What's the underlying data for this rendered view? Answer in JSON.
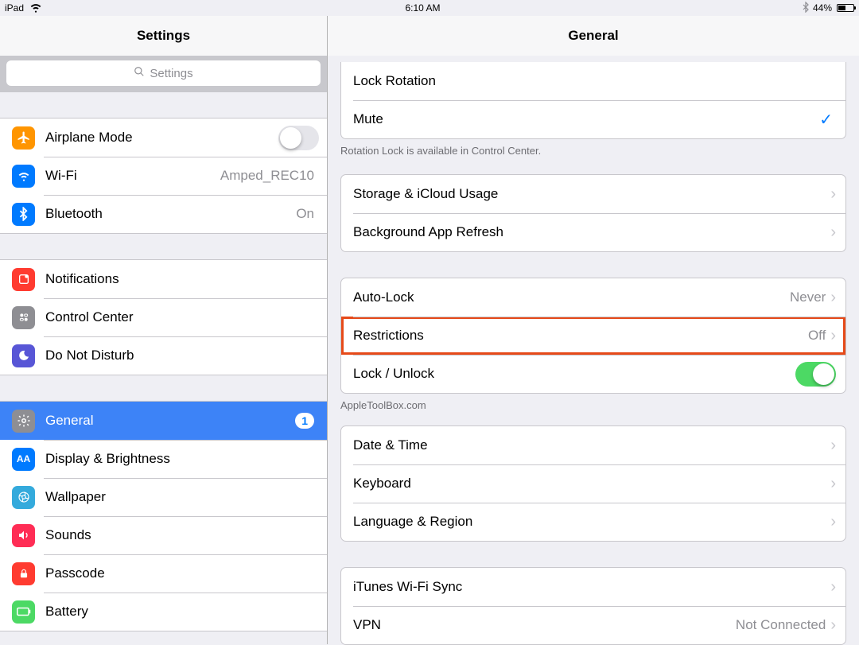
{
  "statusbar": {
    "device": "iPad",
    "time": "6:10 AM",
    "battery_percent": "44%"
  },
  "sidebar": {
    "title": "Settings",
    "search_placeholder": "Settings",
    "rows": {
      "airplane": {
        "label": "Airplane Mode"
      },
      "wifi": {
        "label": "Wi-Fi",
        "value": "Amped_REC10"
      },
      "bluetooth": {
        "label": "Bluetooth",
        "value": "On"
      },
      "notifications": {
        "label": "Notifications"
      },
      "controlcenter": {
        "label": "Control Center"
      },
      "dnd": {
        "label": "Do Not Disturb"
      },
      "general": {
        "label": "General",
        "badge": "1"
      },
      "display": {
        "label": "Display & Brightness"
      },
      "wallpaper": {
        "label": "Wallpaper"
      },
      "sounds": {
        "label": "Sounds"
      },
      "passcode": {
        "label": "Passcode"
      },
      "battery": {
        "label": "Battery"
      }
    }
  },
  "detail": {
    "title": "General",
    "rows": {
      "lockrotation": {
        "label": "Lock Rotation"
      },
      "mute": {
        "label": "Mute"
      },
      "rotation_footer": "Rotation Lock is available in Control Center.",
      "storage": {
        "label": "Storage & iCloud Usage"
      },
      "bgrefresh": {
        "label": "Background App Refresh"
      },
      "autolock": {
        "label": "Auto-Lock",
        "value": "Never"
      },
      "restrictions": {
        "label": "Restrictions",
        "value": "Off"
      },
      "lockunlock": {
        "label": "Lock / Unlock"
      },
      "watermark": "AppleToolBox.com",
      "datetime": {
        "label": "Date & Time"
      },
      "keyboard": {
        "label": "Keyboard"
      },
      "language": {
        "label": "Language & Region"
      },
      "itunessync": {
        "label": "iTunes Wi-Fi Sync"
      },
      "vpn": {
        "label": "VPN",
        "value": "Not Connected"
      }
    }
  },
  "colors": {
    "orange": "#ff9500",
    "blue": "#007aff",
    "red": "#ff3b30",
    "green": "#4cd964",
    "gray": "#8e8e93",
    "purple": "#5856d6",
    "cyan": "#34aadc"
  }
}
